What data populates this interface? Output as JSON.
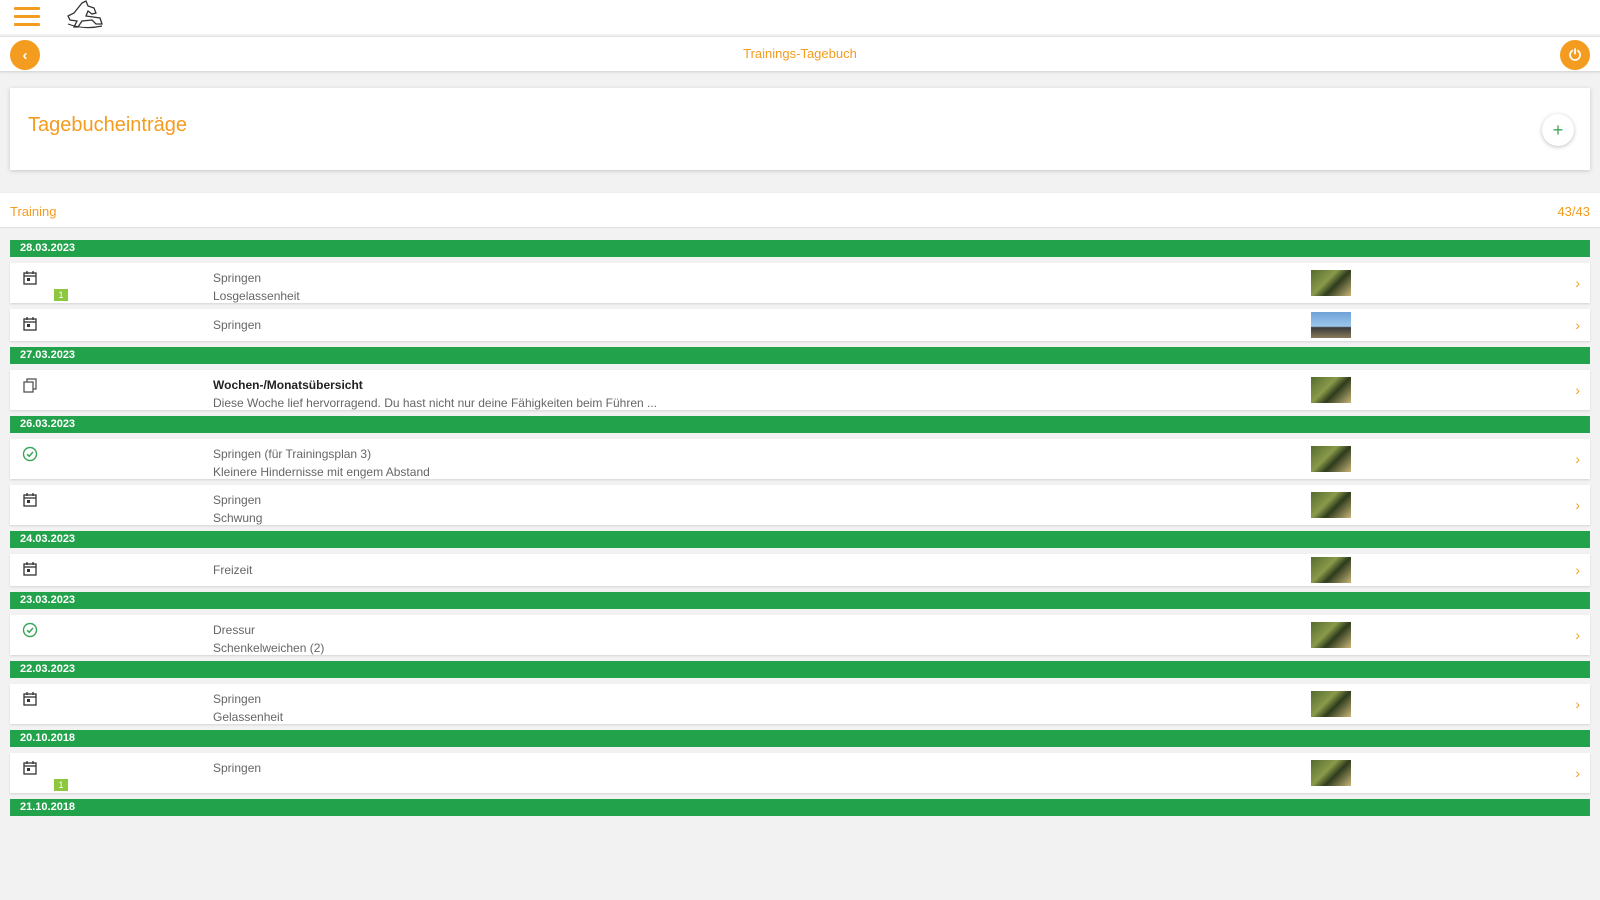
{
  "app": {
    "title": "Trainings-Tagebuch"
  },
  "card": {
    "title": "Tagebucheinträge",
    "add_icon": "plus-icon"
  },
  "filter": {
    "label": "Training",
    "count": "43/43"
  },
  "colors": {
    "accent": "#f39c1f",
    "date_header": "#22a24a",
    "badge": "#8dc63f"
  },
  "groups": [
    {
      "date": "28.03.2023",
      "entries": [
        {
          "icon": "calendar-icon",
          "line1": "Springen",
          "line2": "Losgelassenheit",
          "badge": "1",
          "thumb": "horse-photo"
        },
        {
          "icon": "calendar-icon",
          "line1": "Springen",
          "line2": "",
          "thumb": "horse-photo-sky"
        }
      ]
    },
    {
      "date": "27.03.2023",
      "entries": [
        {
          "icon": "copy-icon",
          "line1": "Wochen-/Monatsübersicht",
          "line2": "Diese Woche lief hervorragend. Du hast nicht nur deine Fähigkeiten beim Führen ...",
          "bold": true,
          "thumb": "horse-photo"
        }
      ]
    },
    {
      "date": "26.03.2023",
      "entries": [
        {
          "icon": "check-circle-icon",
          "line1": "Springen (für Trainingsplan 3)",
          "line2": "Kleinere Hindernisse mit engem Abstand",
          "thumb": "horse-photo"
        },
        {
          "icon": "calendar-icon",
          "line1": "Springen",
          "line2": "Schwung",
          "thumb": "horse-photo"
        }
      ]
    },
    {
      "date": "24.03.2023",
      "entries": [
        {
          "icon": "calendar-icon",
          "line1": "Freizeit",
          "line2": "",
          "thumb": "horse-photo"
        }
      ]
    },
    {
      "date": "23.03.2023",
      "entries": [
        {
          "icon": "check-circle-icon",
          "line1": "Dressur",
          "line2": "Schenkelweichen (2)",
          "thumb": "horse-photo"
        }
      ]
    },
    {
      "date": "22.03.2023",
      "entries": [
        {
          "icon": "calendar-icon",
          "line1": "Springen",
          "line2": "Gelassenheit",
          "thumb": "horse-photo"
        }
      ]
    },
    {
      "date": "20.10.2018",
      "entries": [
        {
          "icon": "calendar-icon",
          "line1": "Springen",
          "line2": "",
          "badge": "1",
          "thumb": "horse-photo"
        }
      ]
    },
    {
      "date": "21.10.2018",
      "entries": []
    }
  ]
}
